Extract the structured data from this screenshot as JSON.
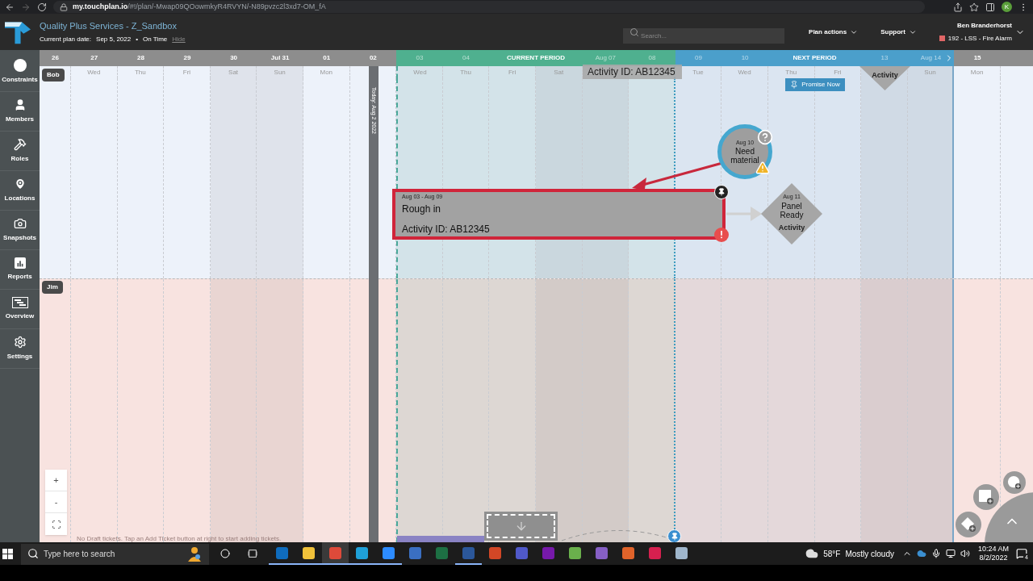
{
  "browser": {
    "url_host": "my.touchplan.io",
    "url_path": "/#!/plan/-Mwap09QOowmkyR4RVYN/-N89pvzc2l3xd7-OM_fA",
    "avatar": "K"
  },
  "header": {
    "title": "Quality Plus Services - Z_Sandbox",
    "plan_date_label": "Current plan date:",
    "plan_date": "Sep 5, 2022",
    "separator": "•",
    "status": "On Time",
    "hide_link": "Hide",
    "search": {
      "placeholder": "Search..."
    },
    "menus": [
      "Plan actions",
      "Support"
    ],
    "user": {
      "name": "Ben Branderhorst",
      "project": "192 - LSS - Fire Alarm"
    }
  },
  "sidebar": {
    "items": [
      {
        "label": "Constraints",
        "kind": "circle"
      },
      {
        "label": "Members",
        "kind": "person"
      },
      {
        "label": "Roles",
        "kind": "hammer"
      },
      {
        "label": "Locations",
        "kind": "pin"
      },
      {
        "label": "Snapshots",
        "kind": "camera"
      },
      {
        "label": "Reports",
        "kind": "chart"
      },
      {
        "label": "Overview",
        "kind": "overview"
      },
      {
        "label": "Settings",
        "kind": "gear"
      }
    ]
  },
  "timeline": {
    "periods": [
      {
        "kind": "current",
        "label": "CURRENT PERIOD"
      },
      {
        "kind": "next",
        "label": "NEXT PERIOD"
      }
    ],
    "days": [
      {
        "date": "26",
        "shaded": false,
        "faded": false,
        "in_current": false,
        "in_next": false
      },
      {
        "date": "27",
        "weekday": "Wed",
        "shaded": false,
        "faded": false,
        "in_current": false,
        "in_next": false
      },
      {
        "date": "28",
        "weekday": "Thu",
        "shaded": false,
        "faded": false,
        "in_current": false,
        "in_next": false
      },
      {
        "date": "29",
        "weekday": "Fri",
        "shaded": false,
        "faded": false,
        "in_current": false,
        "in_next": false
      },
      {
        "date": "30",
        "weekday": "Sat",
        "shaded": true,
        "faded": false,
        "in_current": false,
        "in_next": false
      },
      {
        "date": "Jul 31",
        "weekday": "Sun",
        "shaded": true,
        "faded": false,
        "in_current": false,
        "in_next": false
      },
      {
        "date": "01",
        "weekday": "Mon",
        "shaded": false,
        "faded": false,
        "in_current": false,
        "in_next": false
      },
      {
        "date": "02",
        "shaded": false,
        "faded": false,
        "in_current": false,
        "in_next": false
      },
      {
        "date": "03",
        "weekday": "Wed",
        "shaded": false,
        "faded": true,
        "in_current": true,
        "in_next": false
      },
      {
        "date": "04",
        "weekday": "Thu",
        "shaded": false,
        "faded": true,
        "in_current": true,
        "in_next": false
      },
      {
        "weekday": "Fri",
        "shaded": false,
        "in_current": true,
        "in_next": false
      },
      {
        "weekday": "Sat",
        "shaded": true,
        "in_current": true,
        "in_next": false
      },
      {
        "date": "Aug 07",
        "shaded": true,
        "faded": true,
        "in_current": true,
        "in_next": false
      },
      {
        "date": "08",
        "shaded": false,
        "faded": true,
        "in_current": true,
        "in_next": false
      },
      {
        "date": "09",
        "weekday": "Tue",
        "shaded": false,
        "faded": true,
        "in_current": false,
        "in_next": true
      },
      {
        "date": "10",
        "weekday": "Wed",
        "shaded": false,
        "faded": true,
        "in_current": false,
        "in_next": true
      },
      {
        "weekday": "Thu",
        "shaded": false,
        "in_current": false,
        "in_next": true
      },
      {
        "weekday": "Fri",
        "shaded": false,
        "in_current": false,
        "in_next": true
      },
      {
        "date": "13",
        "shaded": true,
        "faded": true,
        "in_current": false,
        "in_next": true
      },
      {
        "date": "Aug 14",
        "weekday": "Sun",
        "shaded": true,
        "faded": true,
        "in_current": false,
        "in_next": true
      },
      {
        "date": "15",
        "weekday": "Mon",
        "shaded": false,
        "faded": false,
        "in_current": false,
        "in_next": false
      }
    ],
    "today_label": "Today: Aug 2 2022"
  },
  "lanes": [
    {
      "name": "Bob",
      "color": "#edf2fa"
    },
    {
      "name": "Jim",
      "color": "#f8e3e0"
    }
  ],
  "hover_label": "Activity ID: AB12345",
  "partial_milestone": {
    "subtitle": "Activity"
  },
  "promise_button": "Promise Now",
  "ticket": {
    "dates": "Aug 03 - Aug 09",
    "title": "Rough in",
    "subtitle": "Activity ID: AB12345",
    "pinned": true,
    "alert": true
  },
  "constraint": {
    "date": "Aug 10",
    "title": "Need material",
    "question": true,
    "warning": true
  },
  "milestone": {
    "date": "Aug 11",
    "title": "Panel Ready",
    "subtitle": "Activity"
  },
  "zoom_controls": [
    "+",
    "-"
  ],
  "draft_message": "No Draft tickets. Tap an Add Ticket button at right to start adding tickets.",
  "taskbar": {
    "search_placeholder": "Type here to search",
    "apps": [
      {
        "color": "#0f6cbd",
        "open": true,
        "selected": false
      },
      {
        "color": "#f0c13a",
        "open": true,
        "selected": false
      },
      {
        "color": "#de4a3a",
        "open": true,
        "selected": true
      },
      {
        "color": "#1fa0d8",
        "open": true,
        "selected": false
      },
      {
        "color": "#2d8cff",
        "open": true,
        "selected": false
      },
      {
        "color": "#3a6fc2",
        "open": false,
        "selected": false
      },
      {
        "color": "#1d7044",
        "open": false,
        "selected": false
      },
      {
        "color": "#2b579a",
        "open": true,
        "selected": false
      },
      {
        "color": "#d24726",
        "open": false,
        "selected": false
      },
      {
        "color": "#5059c9",
        "open": false,
        "selected": false
      },
      {
        "color": "#7719aa",
        "open": false,
        "selected": false
      },
      {
        "color": "#6ab04c",
        "open": false,
        "selected": false
      },
      {
        "color": "#865fc5",
        "open": false,
        "selected": false
      },
      {
        "color": "#e0632a",
        "open": false,
        "selected": false
      },
      {
        "color": "#d6204f",
        "open": false,
        "selected": false
      },
      {
        "color": "#9fb6cc",
        "open": false,
        "selected": false
      }
    ],
    "weather": {
      "temp": "58°F",
      "text": "Mostly cloudy"
    },
    "time": "10:24 AM",
    "date": "8/2/2022",
    "notifications": "4"
  }
}
